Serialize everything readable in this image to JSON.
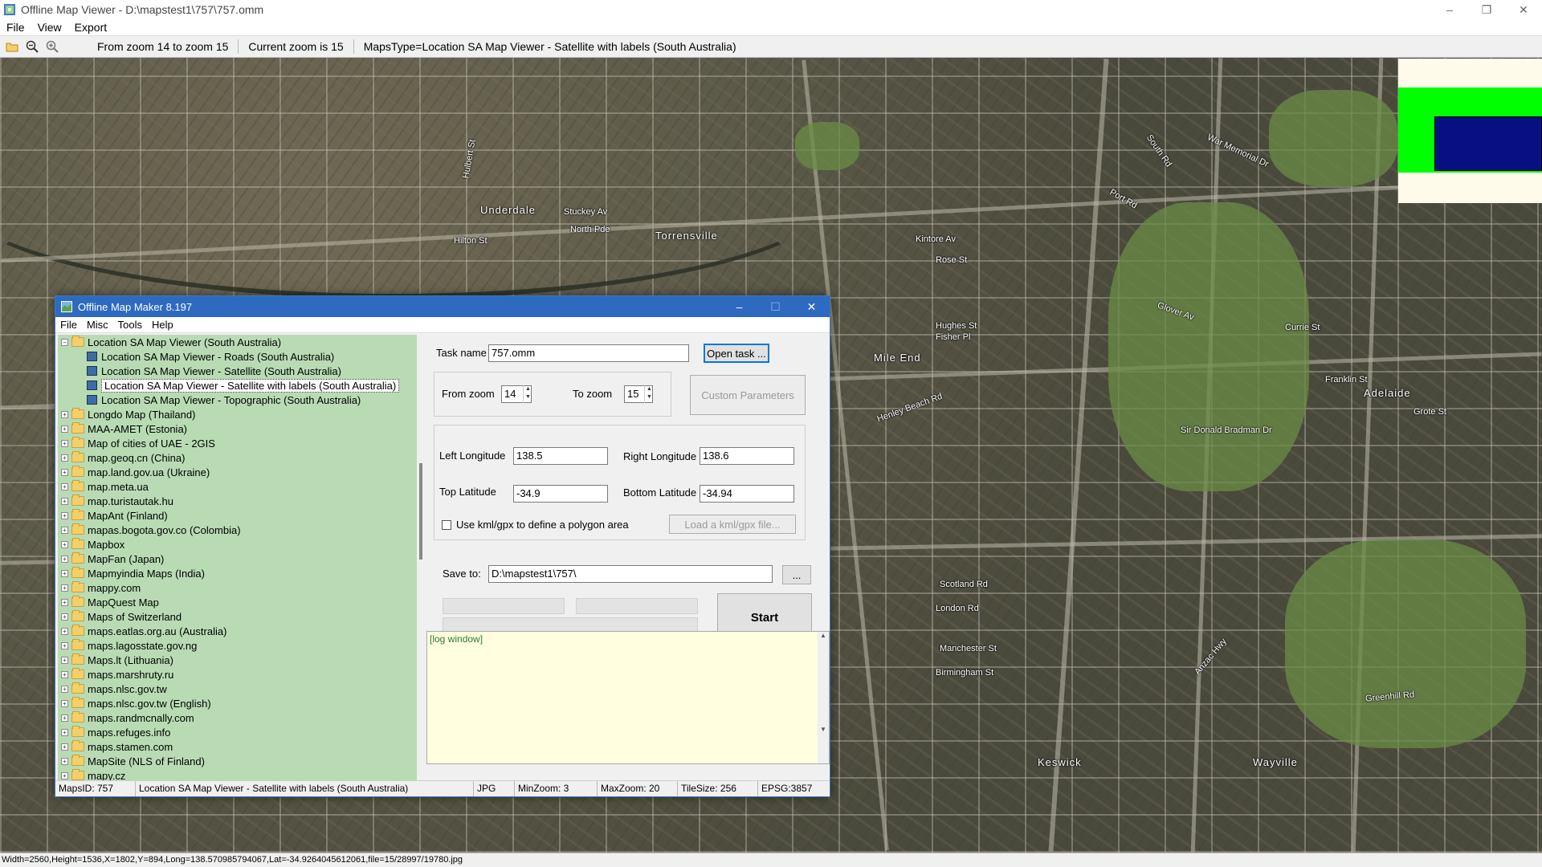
{
  "window": {
    "title": "Offline Map Viewer - D:\\mapstest1\\757\\757.omm",
    "controls": {
      "minimize": "–",
      "maximize": "❐",
      "close": "✕"
    }
  },
  "menu": [
    "File",
    "View",
    "Export"
  ],
  "toolbar": {
    "zoom_range": "From zoom 14 to zoom 15",
    "current_zoom": "Current zoom is 15",
    "maps_type": "MapsType=Location SA Map Viewer - Satellite with labels (South Australia)"
  },
  "map_labels": [
    "Underdale",
    "Torrensville",
    "Mile End",
    "Adelaide",
    "Keswick",
    "Wayville",
    "Port Rd",
    "Henley Beach Rd",
    "Sir Donald Bradman Dr",
    "South Rd",
    "Greenhill Rd",
    "War Memorial Dr",
    "Grote St",
    "Franklin St",
    "Currie St",
    "Glover Av",
    "Anzac Hwy",
    "Scotland Rd",
    "London Rd",
    "Manchester St",
    "Birmingham St",
    "Kintore Av",
    "Rose St",
    "Hughes St",
    "Fisher Pl",
    "Stuckey Av",
    "Hilton St",
    "North Pde",
    "Hulbert St"
  ],
  "status_bar": "Width=2560,Height=1536,X=1802,Y=894,Long=138.570985794067,Lat=-34.9264045612061,file=15/28997/19780.jpg",
  "overview": {
    "bg": "#fffbeb",
    "viewport": "#00ff00",
    "selection": "#061080"
  },
  "dialog": {
    "title": "Offline Map Maker 8.197",
    "controls": {
      "minimize": "–",
      "maximize": "☐",
      "close": "✕"
    },
    "menu": [
      "File",
      "Misc",
      "Tools",
      "Help"
    ],
    "tree": {
      "root": "Location SA Map Viewer (South Australia)",
      "children": [
        "Location SA Map Viewer - Roads (South Australia)",
        "Location SA Map Viewer - Satellite (South Australia)",
        "Location SA Map Viewer - Satellite with labels (South Australia)",
        "Location SA Map Viewer - Topographic (South Australia)"
      ],
      "selected_index": 2,
      "others": [
        "Longdo Map (Thailand)",
        "MAA-AMET (Estonia)",
        "Map of cities of UAE - 2GIS",
        "map.geoq.cn (China)",
        "map.land.gov.ua (Ukraine)",
        "map.meta.ua",
        "map.turistautak.hu",
        "MapAnt (Finland)",
        "mapas.bogota.gov.co (Colombia)",
        "Mapbox",
        "MapFan (Japan)",
        "Mapmyindia Maps (India)",
        "mappy.com",
        "MapQuest Map",
        "Maps of Switzerland",
        "maps.eatlas.org.au (Australia)",
        "maps.lagosstate.gov.ng",
        "Maps.lt (Lithuania)",
        "maps.marshruty.ru",
        "maps.nlsc.gov.tw",
        "maps.nlsc.gov.tw (English)",
        "maps.randmcnally.com",
        "maps.refuges.info",
        "maps.stamen.com",
        "MapSite (NLS of Finland)",
        "mapy.cz"
      ]
    },
    "form": {
      "task_name_label": "Task name",
      "task_name": "757.omm",
      "open_task": "Open task ...",
      "from_zoom_label": "From zoom",
      "from_zoom": "14",
      "to_zoom_label": "To zoom",
      "to_zoom": "15",
      "custom_params": "Custom Parameters",
      "left_lon_label": "Left Longitude",
      "left_lon": "138.5",
      "right_lon_label": "Right Longitude",
      "right_lon": "138.6",
      "top_lat_label": "Top Latitude",
      "top_lat": "-34.9",
      "bottom_lat_label": "Bottom Latitude",
      "bottom_lat": "-34.94",
      "kml_label": "Use kml/gpx to define a polygon area",
      "load_kml": "Load a kml/gpx file...",
      "save_to_label": "Save to:",
      "save_to": "D:\\mapstest1\\757\\",
      "browse": "...",
      "start": "Start"
    },
    "log": "[log window]",
    "status": {
      "maps_id": "MapsID: 757",
      "map_name": "Location SA Map Viewer - Satellite with labels (South Australia)",
      "format": "JPG",
      "min_zoom": "MinZoom: 3",
      "max_zoom": "MaxZoom: 20",
      "tile_size": "TileSize: 256",
      "epsg": "EPSG:3857"
    }
  }
}
